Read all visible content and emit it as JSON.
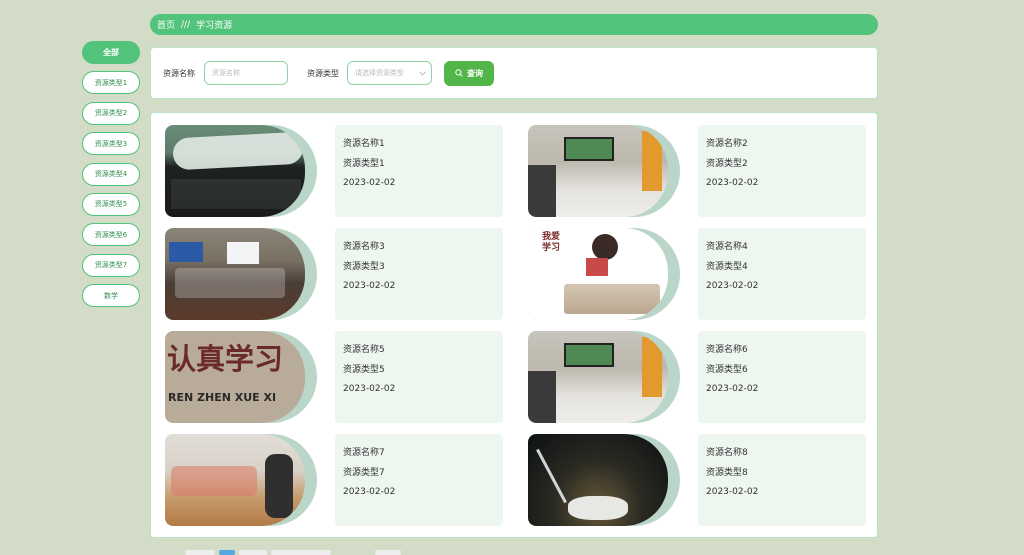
{
  "breadcrumb": {
    "home": "首页",
    "separator": "///",
    "current": "学习资源"
  },
  "sidebar": {
    "items": [
      {
        "label": "全部",
        "active": true
      },
      {
        "label": "资源类型1"
      },
      {
        "label": "资源类型2"
      },
      {
        "label": "资源类型3"
      },
      {
        "label": "资源类型4"
      },
      {
        "label": "资源类型5"
      },
      {
        "label": "资源类型6"
      },
      {
        "label": "资源类型7"
      },
      {
        "label": "数学"
      }
    ]
  },
  "search": {
    "name_label": "资源名称",
    "name_placeholder": "资源名称",
    "type_label": "资源类型",
    "type_placeholder": "请选择资源类型",
    "button_label": "查询"
  },
  "cards": [
    {
      "name": "资源名称1",
      "type": "资源类型1",
      "date": "2023-02-02",
      "image": "calligraphy-woaixuexi"
    },
    {
      "name": "资源名称2",
      "type": "资源类型2",
      "date": "2023-02-02",
      "image": "classroom-photo"
    },
    {
      "name": "资源名称3",
      "type": "资源类型3",
      "date": "2023-02-02",
      "image": "classroom-students"
    },
    {
      "name": "资源名称4",
      "type": "资源类型4",
      "date": "2023-02-02",
      "image": "cartoon-girl-reading",
      "image_text": "我爱\n学习"
    },
    {
      "name": "资源名称5",
      "type": "资源类型5",
      "date": "2023-02-02",
      "image": "renzhen-xuexi-sign",
      "image_text": "认真学习",
      "image_subtext": "REN ZHEN XUE XI"
    },
    {
      "name": "资源名称6",
      "type": "资源类型6",
      "date": "2023-02-02",
      "image": "classroom-photo"
    },
    {
      "name": "资源名称7",
      "type": "资源类型7",
      "date": "2023-02-02",
      "image": "kids-reading-floor"
    },
    {
      "name": "资源名称8",
      "type": "资源类型8",
      "date": "2023-02-02",
      "image": "desk-lamp-book"
    }
  ],
  "colors": {
    "accent": "#52c37a",
    "button": "#52b548",
    "card_bg": "#eef6f0",
    "page_bg": "#d2dcc6"
  }
}
